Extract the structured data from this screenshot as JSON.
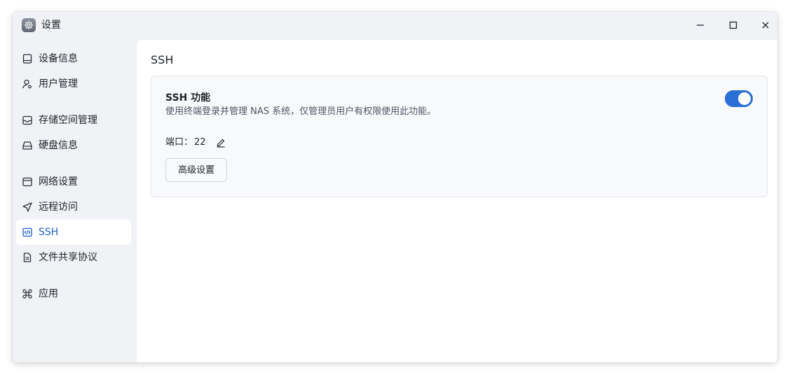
{
  "window": {
    "title": "设置",
    "app_icon": "gear-icon",
    "controls": [
      "minimize-icon",
      "maximize-icon",
      "close-icon"
    ]
  },
  "sidebar": {
    "items": [
      {
        "label": "设备信息",
        "icon": "device-icon"
      },
      {
        "label": "用户管理",
        "icon": "user-gear-icon"
      },
      {
        "label": "存储空间管理",
        "icon": "storage-icon"
      },
      {
        "label": "硬盘信息",
        "icon": "disk-icon"
      },
      {
        "label": "网络设置",
        "icon": "network-icon"
      },
      {
        "label": "远程访问",
        "icon": "send-icon"
      },
      {
        "label": "SSH",
        "icon": "code-icon",
        "active": true
      },
      {
        "label": "文件共享协议",
        "icon": "document-icon"
      },
      {
        "label": "应用",
        "icon": "command-icon"
      }
    ]
  },
  "main": {
    "title": "SSH",
    "card": {
      "title": "SSH 功能",
      "description": "使用终端登录并管理 NAS 系统，仅管理员用户有权限使用此功能。",
      "toggle_enabled": true,
      "port_label": "端口：",
      "port_value": "22",
      "advanced_button": "高级设置"
    }
  },
  "colors": {
    "accent": "#2a6fd6",
    "active_text": "#1d5fc4",
    "sidebar_bg": "#f1f2f6",
    "content_bg": "#ffffff"
  }
}
